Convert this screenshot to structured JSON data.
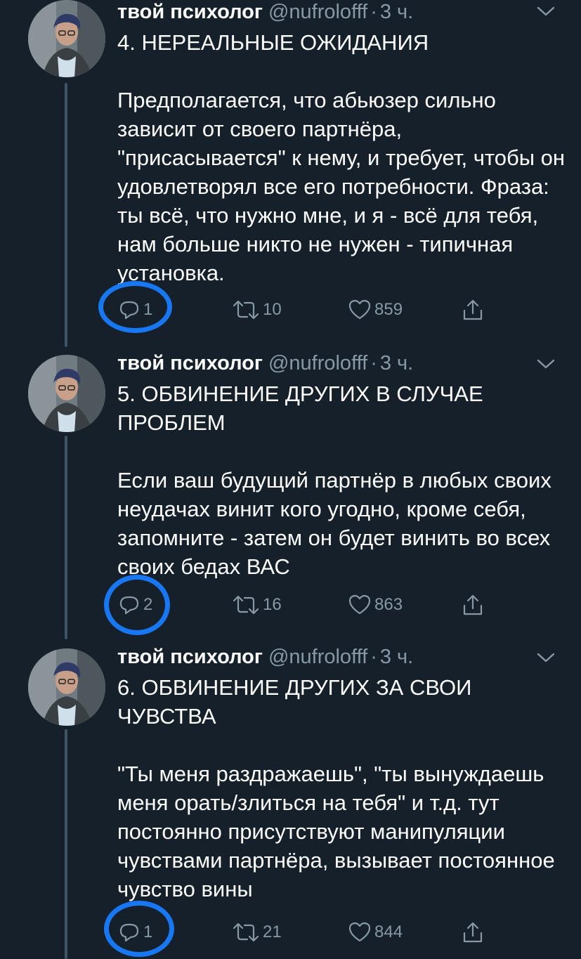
{
  "tweets": [
    {
      "author_name": "твой психолог",
      "handle": "@nufrolofff",
      "separator": "·",
      "time": "3 ч.",
      "text": "4. НЕРЕАЛЬНЫЕ ОЖИДАНИЯ\n\nПредполагается, что абьюзер сильно зависит от своего партнёра, \"присасывается\" к нему, и требует, чтобы он удовлетворял все его потребности. Фраза: ты всё, что нужно мне, и я - всё для тебя, нам больше никто не нужен - типичная установка.",
      "replies": "1",
      "retweets": "10",
      "likes": "859"
    },
    {
      "author_name": "твой психолог",
      "handle": "@nufrolofff",
      "separator": "·",
      "time": "3 ч.",
      "text": "5. ОБВИНЕНИЕ ДРУГИХ В СЛУЧАЕ ПРОБЛЕМ\n\nЕсли ваш будущий партнёр в любых своих неудачах винит кого угодно, кроме себя, запомните - затем он будет винить во всех своих бедах ВАС",
      "replies": "2",
      "retweets": "16",
      "likes": "863"
    },
    {
      "author_name": "твой психолог",
      "handle": "@nufrolofff",
      "separator": "·",
      "time": "3 ч.",
      "text": "6. ОБВИНЕНИЕ ДРУГИХ ЗА СВОИ ЧУВСТВА\n\n\"Ты меня раздражаешь\", \"ты вынуждаешь меня орать/злиться на тебя\" и т.д. тут постоянно присутствуют манипуляции чувствами партнёра, вызывает постоянное чувство вины",
      "replies": "1",
      "retweets": "21",
      "likes": "844"
    }
  ],
  "icons": {
    "reply": "reply-icon",
    "retweet": "retweet-icon",
    "like": "heart-icon",
    "share": "share-icon",
    "menu": "chevron-down-icon"
  },
  "colors": {
    "background": "#15202b",
    "secondary_text": "#8899a6",
    "thread_line": "#3d5466",
    "highlight_circle": "#1877f2"
  }
}
